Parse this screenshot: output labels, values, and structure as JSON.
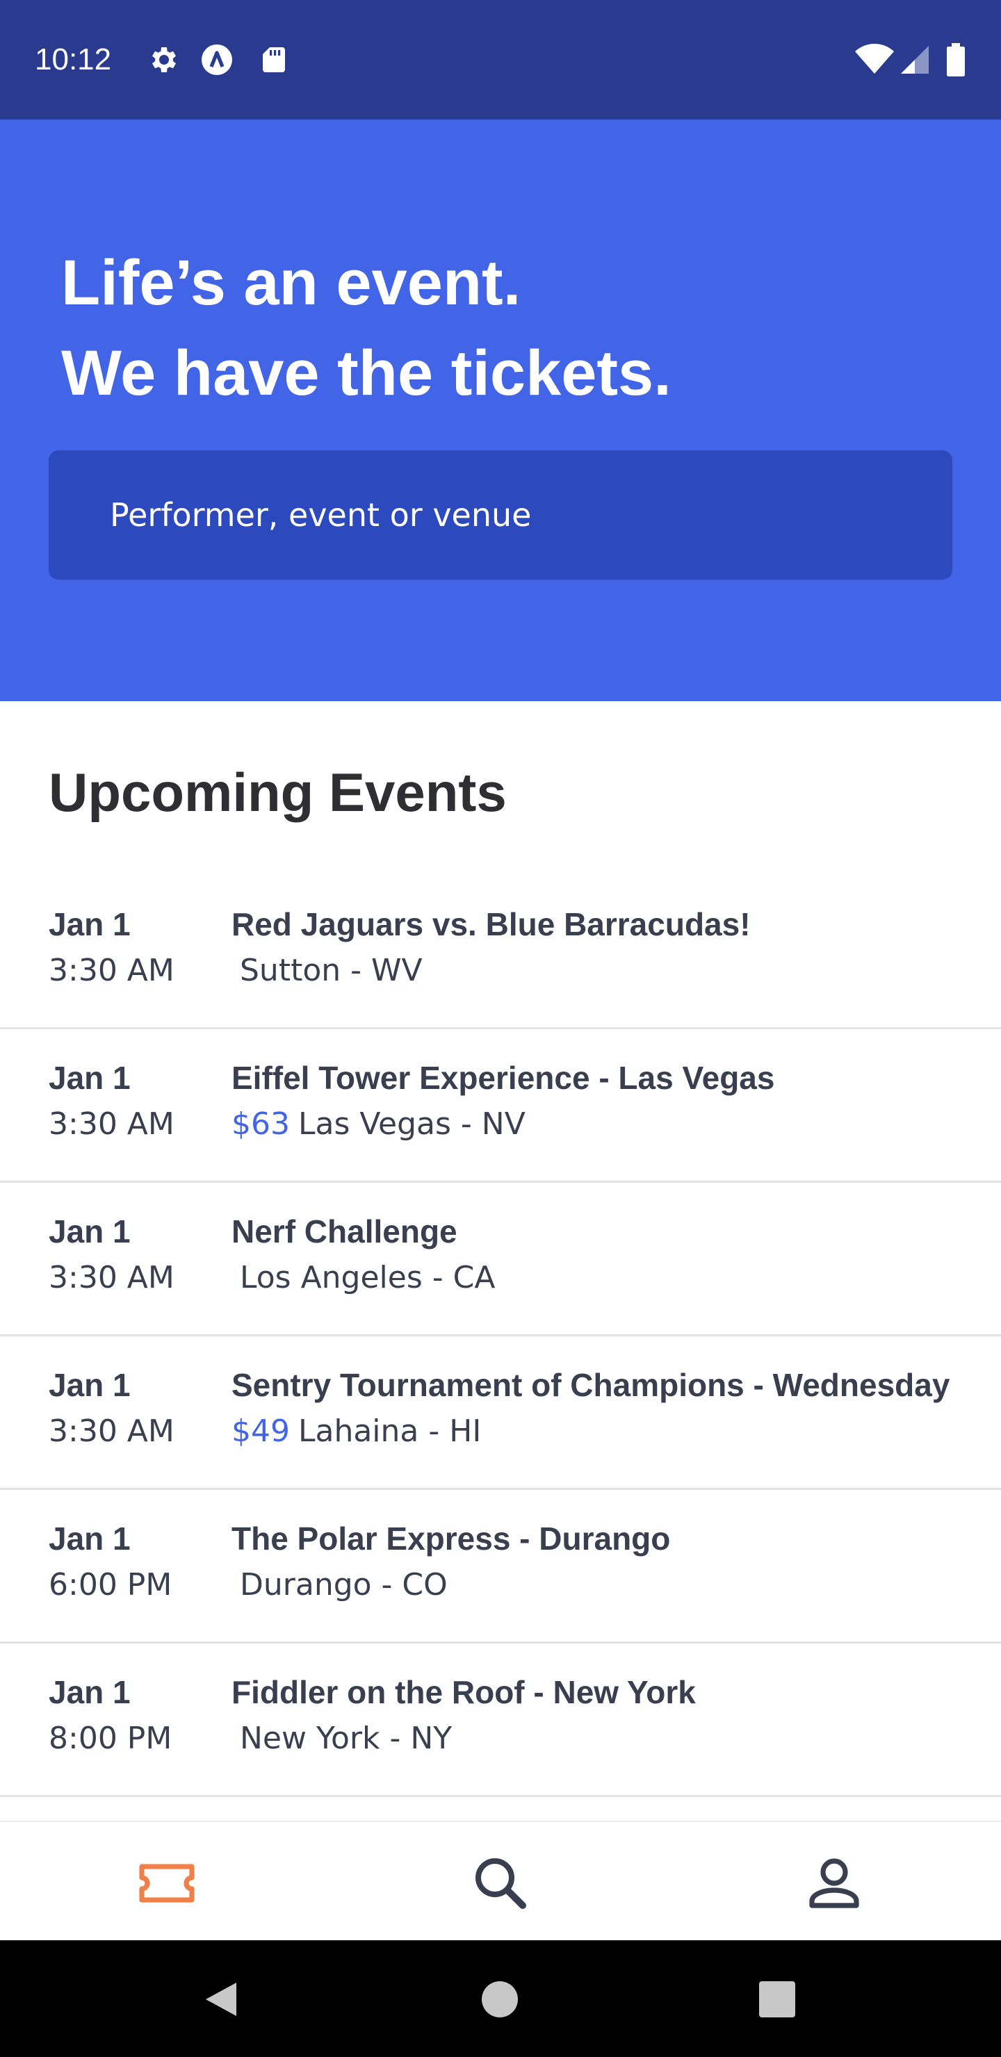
{
  "status_bar": {
    "time": "10:12",
    "left_icons": [
      "gear-icon",
      "a-circle-icon",
      "sd-card-icon"
    ],
    "right_icons": [
      "wifi-icon",
      "cell-signal-icon",
      "battery-icon"
    ]
  },
  "hero": {
    "title_line1": "Life’s an event.",
    "title_line2": "We have the tickets.",
    "search_placeholder": "Performer, event or venue"
  },
  "events_section": {
    "title": "Upcoming Events",
    "events": [
      {
        "date": "Jan 1",
        "time": "3:30 AM",
        "name": "Red Jaguars vs. Blue Barracudas!",
        "price": "",
        "location": "Sutton - WV"
      },
      {
        "date": "Jan 1",
        "time": "3:30 AM",
        "name": "Eiffel Tower Experience - Las Vegas",
        "price": "$63",
        "location": "Las Vegas - NV"
      },
      {
        "date": "Jan 1",
        "time": "3:30 AM",
        "name": "Nerf Challenge",
        "price": "",
        "location": "Los Angeles - CA"
      },
      {
        "date": "Jan 1",
        "time": "3:30 AM",
        "name": "Sentry Tournament of Champions - Wednesday",
        "price": "$49",
        "location": "Lahaina - HI"
      },
      {
        "date": "Jan 1",
        "time": "6:00 PM",
        "name": "The Polar Express - Durango",
        "price": "",
        "location": "Durango - CO"
      },
      {
        "date": "Jan 1",
        "time": "8:00 PM",
        "name": "Fiddler on the Roof - New York",
        "price": "",
        "location": "New York - NY"
      }
    ]
  },
  "bottom_nav": {
    "items": [
      "ticket-icon",
      "search-icon",
      "profile-icon"
    ],
    "active_index": 0
  },
  "colors": {
    "status_bar": "#2a3a8e",
    "hero": "#4265e8",
    "search_box": "#2c4abe",
    "price": "#4265e8",
    "active_nav": "#f0804a",
    "text": "#3a3f4f"
  }
}
